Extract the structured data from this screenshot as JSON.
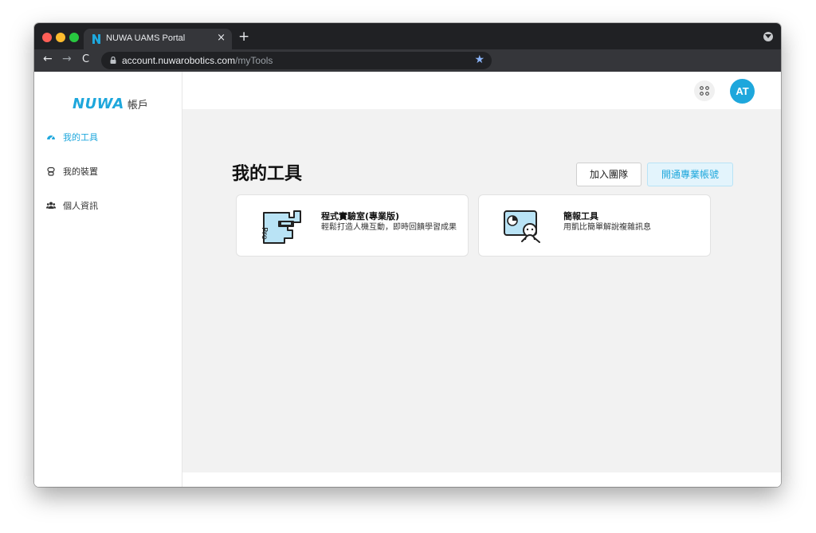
{
  "browser": {
    "tab_title": "NUWA UAMS Portal",
    "tab_close": "×",
    "new_tab": "+",
    "url_host": "account.nuwarobotics.com",
    "url_path": "/myTools",
    "nav_back": "←",
    "nav_forward": "→",
    "nav_reload": "C",
    "bookmark_star": "★"
  },
  "sidebar": {
    "brand_logo": "NUWA",
    "brand_text": "帳戶",
    "items": [
      {
        "label": "我的工具",
        "icon": "dashboard-icon",
        "active": true
      },
      {
        "label": "我的裝置",
        "icon": "robot-icon",
        "active": false
      },
      {
        "label": "個人資訊",
        "icon": "users-icon",
        "active": false
      }
    ]
  },
  "header": {
    "avatar_initials": "AT",
    "apps_icon": "apps-grid-icon"
  },
  "main": {
    "title": "我的工具",
    "join_team_label": "加入團隊",
    "upgrade_label": "開通專業帳號",
    "cards": [
      {
        "title": "程式實驗室(專業版)",
        "desc": "輕鬆打造人機互動，即時回饋學習成果",
        "icon": "code-lab-pro-icon"
      },
      {
        "title": "簡報工具",
        "desc": "用凱比簡單解說複雜訊息",
        "icon": "presentation-tool-icon"
      }
    ]
  },
  "colors": {
    "accent": "#1ea7dc",
    "upgrade_bg": "#e3f4fc",
    "main_bg": "#f2f2f2",
    "icon_fill": "#b9e3f5"
  }
}
